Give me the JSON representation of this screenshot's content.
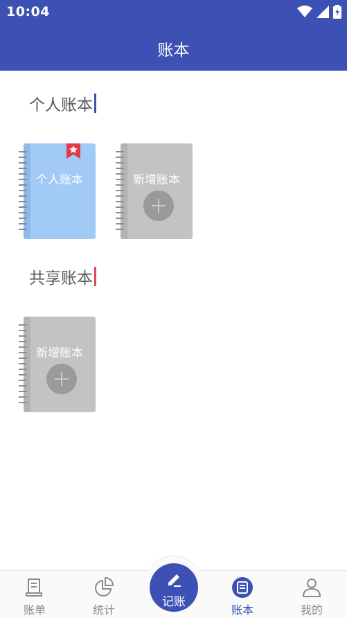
{
  "status_bar": {
    "time": "10:04"
  },
  "app_bar": {
    "title": "账本"
  },
  "personal_section": {
    "title": "个人账本",
    "books": [
      {
        "label": "个人账本",
        "type": "ledger",
        "color": "#9fc8f4",
        "starred": true
      },
      {
        "label": "新增账本",
        "type": "add"
      }
    ]
  },
  "shared_section": {
    "title": "共享账本",
    "books": [
      {
        "label": "新增账本",
        "type": "add"
      }
    ]
  },
  "bottom_nav": {
    "items": [
      {
        "label": "账单",
        "icon": "bill-icon"
      },
      {
        "label": "统计",
        "icon": "pie-chart-icon"
      },
      {
        "label": "记账",
        "icon": "edit-icon"
      },
      {
        "label": "账本",
        "icon": "ledger-icon",
        "active": true
      },
      {
        "label": "我的",
        "icon": "user-icon"
      }
    ]
  },
  "colors": {
    "primary": "#3d51b5",
    "personal_accent": "#3d51b5",
    "shared_accent": "#e0484b",
    "ribbon": "#e3394a"
  }
}
